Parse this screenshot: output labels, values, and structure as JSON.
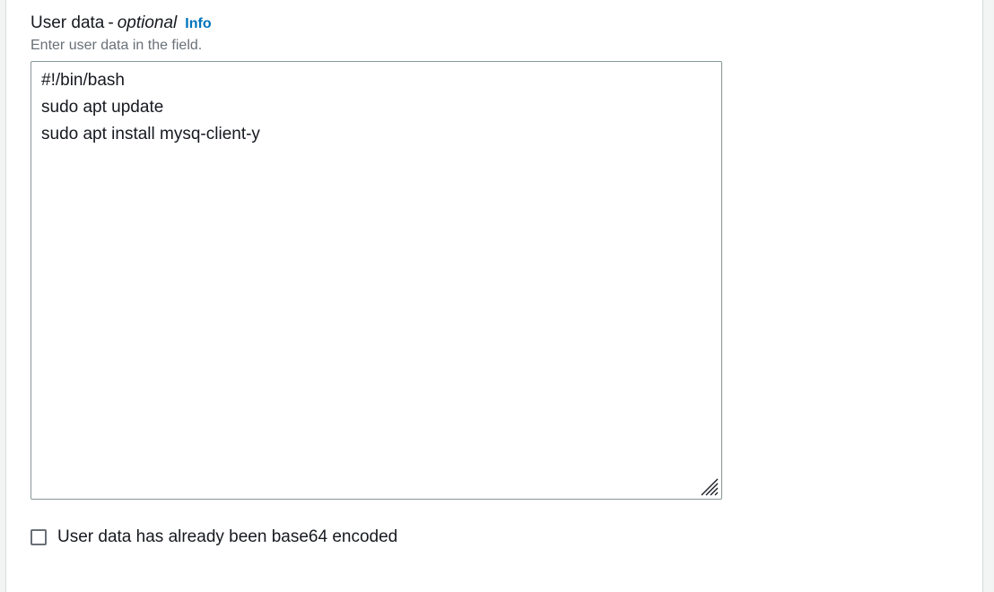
{
  "field": {
    "label": "User data",
    "separator": "-",
    "optional_text": "optional",
    "info_link": "Info",
    "description": "Enter user data in the field.",
    "value": "#!/bin/bash\nsudo apt update\nsudo apt install mysq-client-y"
  },
  "base64_option": {
    "label": "User data has already been base64 encoded",
    "checked": false
  },
  "colors": {
    "link": "#0073bb",
    "text": "#16191f",
    "secondary_text": "#687078",
    "border": "#879596"
  }
}
